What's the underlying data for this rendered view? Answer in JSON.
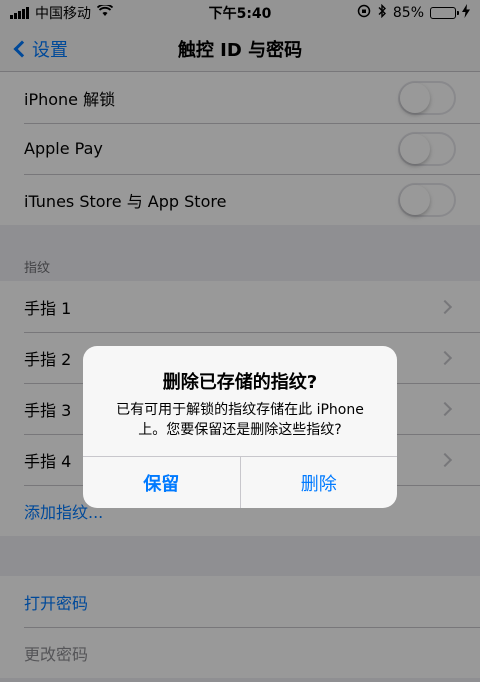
{
  "status_bar": {
    "carrier": "中国移动",
    "time": "下午5:40",
    "battery": "85%",
    "battery_fraction": 0.85
  },
  "nav": {
    "back_label": "设置",
    "title": "触控 ID 与密码"
  },
  "toggles": [
    {
      "label": "iPhone 解锁",
      "on": false
    },
    {
      "label": "Apple Pay",
      "on": false
    },
    {
      "label": "iTunes Store 与 App Store",
      "on": false
    }
  ],
  "fingerprints": {
    "header": "指纹",
    "items": [
      {
        "label": "手指 1"
      },
      {
        "label": "手指 2"
      },
      {
        "label": "手指 3"
      },
      {
        "label": "手指 4"
      }
    ],
    "add_label": "添加指纹..."
  },
  "passcode": {
    "turn_on": "打开密码",
    "change": "更改密码"
  },
  "alert": {
    "title": "删除已存储的指纹?",
    "message": "已有可用于解锁的指纹存储在此 iPhone 上。您要保留还是删除这些指纹?",
    "keep_label": "保留",
    "delete_label": "删除"
  },
  "colors": {
    "accent": "#007aff",
    "battery_green": "#4cd964"
  }
}
